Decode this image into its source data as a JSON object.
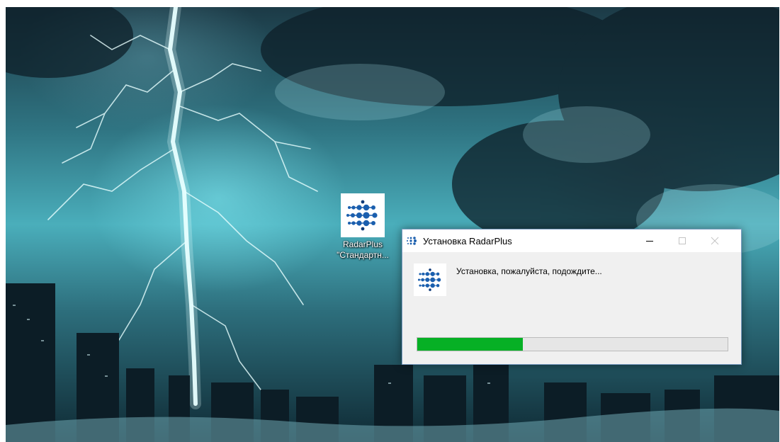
{
  "desktop": {
    "icon": {
      "name_line1": "RadarPlus",
      "name_line2": "\"Стандартн...",
      "icon_name": "radarplus-logo-icon"
    }
  },
  "installer": {
    "title": "Установка RadarPlus",
    "status_text": "Установка, пожалуйста, подождите...",
    "progress_percent": 34,
    "progress_color": "#06b025",
    "buttons": {
      "minimize_icon": "minimize-icon",
      "maximize_icon": "maximize-icon",
      "close_icon": "close-icon"
    }
  }
}
